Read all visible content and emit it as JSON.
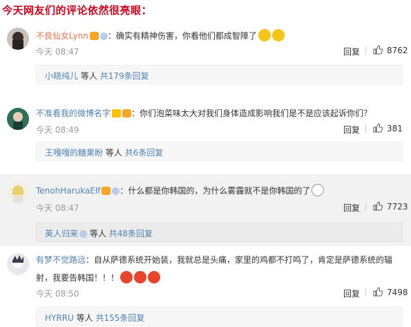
{
  "heading": "今天网友们的评论依然很亮眼：",
  "comments": [
    {
      "user": "不良仙女Lynn",
      "text": "：确实有精神伤害，你看他们都成智障了",
      "time": "今天 08:47",
      "reply_label": "回复",
      "likes": "8762",
      "replier": "小晓纯儿",
      "others": "等人",
      "reply_count": "共179条回复"
    },
    {
      "user": "不准看我的微博名字",
      "text": "：你们泡菜味太大对我们身体造成影响我们是不是应该起诉你们？",
      "time": "今天 08:49",
      "reply_label": "回复",
      "likes": "381",
      "replier": "王嘎嘎的糖果盼",
      "others": "等人",
      "reply_count": "共6条回复"
    },
    {
      "user": "TenohHarukaElf",
      "text": "：什么都是你韩国的，为什么雾霾就不是你韩国的了",
      "time": "今天 08:47",
      "reply_label": "回复",
      "likes": "7723",
      "replier": "英人归来",
      "others": "等人",
      "reply_count": "共48条回复"
    },
    {
      "user": "有梦不觉路远",
      "text": "：自从萨德系统开始装，我就总是头痛，家里的鸡都不打鸣了，肯定是萨德系统的辐",
      "text2": "射，我要告韩国！！！",
      "time": "今天 08:50",
      "reply_label": "回复",
      "likes": "7498",
      "replier": "HYRRU",
      "others": "等人",
      "reply_count": "共155条回复"
    }
  ],
  "colors": {
    "heading": "#d0021b",
    "username": "#eb7350",
    "link": "#4f82b7",
    "timestamp": "#999999"
  }
}
